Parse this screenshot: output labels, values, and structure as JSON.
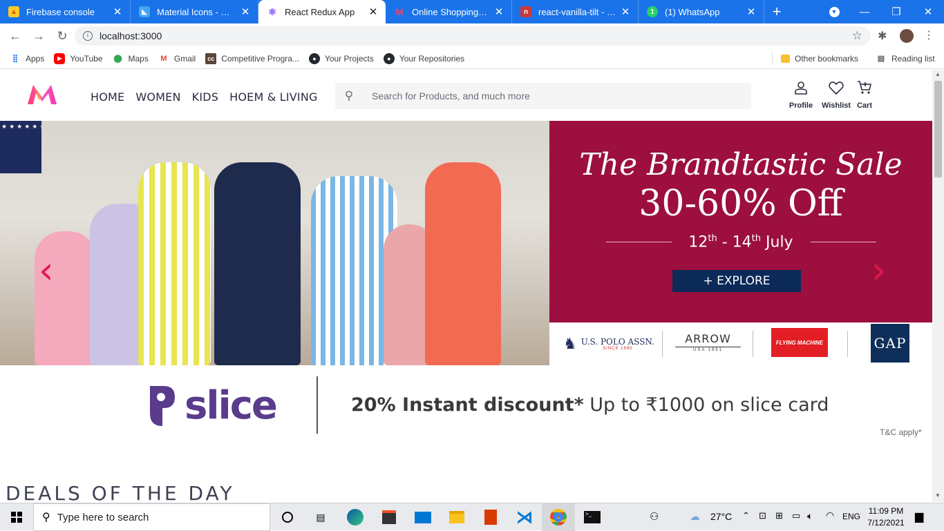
{
  "browser": {
    "tabs": [
      {
        "title": "Firebase console",
        "fav_color": "#ffca28"
      },
      {
        "title": "Material Icons - Mater",
        "fav_color": "#42a5f5"
      },
      {
        "title": "React Redux App",
        "fav_color": "#7c4dff"
      },
      {
        "title": "Online Shopping for W",
        "fav_color": "#ff3f6c"
      },
      {
        "title": "react-vanilla-tilt - npm",
        "fav_color": "#cb3837"
      },
      {
        "title": "(1) WhatsApp",
        "fav_color": "#25d366",
        "badge": "1"
      }
    ],
    "new_tab_symbol": "+",
    "url": "localhost:3000",
    "bookmarks": [
      {
        "label": "Apps"
      },
      {
        "label": "YouTube"
      },
      {
        "label": "Maps"
      },
      {
        "label": "Gmail"
      },
      {
        "label": "Competitive Progra..."
      },
      {
        "label": "Your Projects"
      },
      {
        "label": "Your Repositories"
      }
    ],
    "other_bookmarks": "Other bookmarks",
    "reading_list": "Reading list"
  },
  "site": {
    "nav": [
      "HOME",
      "WOMEN",
      "KIDS",
      "HOEM & LIVING"
    ],
    "search_placeholder": "Search for Products, and much more",
    "profile_label": "Profile",
    "wishlist_label": "Wishlist",
    "cart_label": "Cart"
  },
  "banner": {
    "headline": "The Brandtastic Sale",
    "discount": "30-60% Off",
    "dates_start": "12",
    "dates_start_sup": "th",
    "dates_sep": " - 14",
    "dates_end_sup": "th",
    "dates_month": " July",
    "cta": "+ EXPLORE",
    "brands": [
      "U.S. POLO ASSN.",
      "SINCE 1890",
      "ARROW",
      "USA 1851",
      "FLYING MACHINE",
      "GAP"
    ],
    "prev_symbol": "‹",
    "next_symbol": "›"
  },
  "slice": {
    "brand": "slice",
    "offer_bold": "20% Instant discount*",
    "offer_rest": " Up to ₹1000 on slice card",
    "terms": "T&C apply*"
  },
  "deals_heading": "DEALS OF THE DAY",
  "taskbar": {
    "search_placeholder": "Type here to search",
    "weather": "27°C",
    "language": "ENG",
    "time": "11:09 PM",
    "date": "7/12/2021"
  },
  "colors": {
    "chrome_blue": "#1a73e8",
    "myntra_pink": "#ff3f6c",
    "promo_maroon": "#9c0f3f",
    "explore_navy": "#0b2a57",
    "slice_purple": "#5a3b8c"
  }
}
